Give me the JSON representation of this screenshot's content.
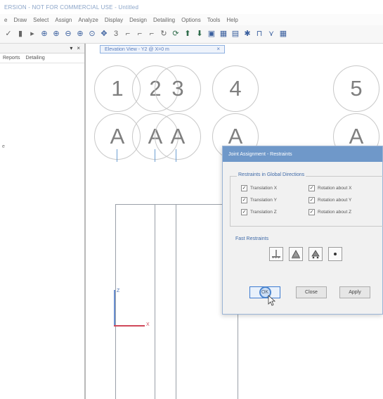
{
  "app": {
    "title": "ERSION - NOT FOR COMMERCIAL USE - Untitled"
  },
  "menu": [
    "e",
    "Draw",
    "Select",
    "Assign",
    "Analyze",
    "Display",
    "Design",
    "Detailing",
    "Options",
    "Tools",
    "Help"
  ],
  "toolbar": {
    "icons": [
      "save-icon",
      "play-icon",
      "zoom-in-icon",
      "zoom-window-icon",
      "zoom-out-icon",
      "zoom-previous-icon",
      "zoom-fit-icon",
      "pan-icon",
      "3d-view-icon",
      "xy-view-icon",
      "xz-view-icon",
      "yz-view-icon",
      "rotate-icon",
      "refresh-icon",
      "move-up-icon",
      "move-down-icon",
      "object-shrink-icon",
      "grid-icon",
      "display-icon",
      "settings-icon",
      "frame-icon",
      "beam-icon",
      "brace-icon"
    ]
  },
  "left_panel": {
    "pin_label": "▾",
    "close_label": "×",
    "tabs": [
      "Reports",
      "Detailing"
    ],
    "side_marker": "e"
  },
  "view_tab": {
    "label": "Elevation View - Y2 @ X=0 m",
    "close": "×"
  },
  "grid": {
    "columns": [
      "1",
      "2",
      "3",
      "4",
      "5"
    ],
    "rows": [
      "A",
      "A",
      "A",
      "A",
      "A"
    ]
  },
  "axis": {
    "z_label": "Z",
    "x_label": "X"
  },
  "dialog": {
    "title": "Joint Assignment - Restraints",
    "group_label": "Restraints in Global Directions",
    "checkboxes": [
      {
        "label": "Translation X",
        "checked": true
      },
      {
        "label": "Rotation about X",
        "checked": true
      },
      {
        "label": "Translation Y",
        "checked": true
      },
      {
        "label": "Rotation about Y",
        "checked": true
      },
      {
        "label": "Translation Z",
        "checked": true
      },
      {
        "label": "Rotation about Z",
        "checked": true
      }
    ],
    "fast_label": "Fast Restraints",
    "fast_buttons": [
      "fixed-support-icon",
      "pinned-support-icon",
      "roller-support-icon",
      "free-joint-icon"
    ],
    "buttons": {
      "ok": "OK",
      "close": "Close",
      "apply": "Apply"
    }
  }
}
